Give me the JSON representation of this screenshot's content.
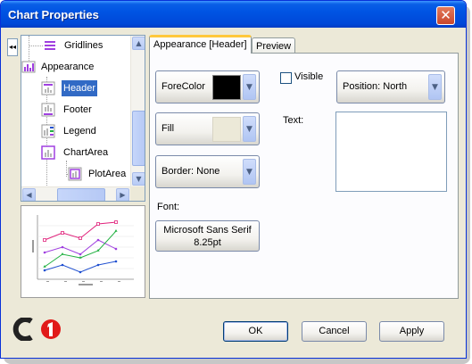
{
  "window": {
    "title": "Chart Properties"
  },
  "tree": {
    "items": [
      {
        "label": "Gridlines"
      },
      {
        "label": "Appearance"
      },
      {
        "label": "Header",
        "selected": true
      },
      {
        "label": "Footer"
      },
      {
        "label": "Legend"
      },
      {
        "label": "ChartArea"
      },
      {
        "label": "PlotArea"
      }
    ]
  },
  "preview_chart": {
    "series_colors": [
      "#e0207a",
      "#a040e0",
      "#20b040",
      "#2050d0"
    ]
  },
  "tabs": [
    {
      "label": "Appearance [Header]",
      "active": true
    },
    {
      "label": "Preview",
      "active": false
    }
  ],
  "appearance": {
    "forecolor_label": "ForeColor",
    "forecolor_value": "#000000",
    "fill_label": "Fill",
    "fill_value": "#ece9d8",
    "border_label": "Border: None",
    "visible_label": "Visible",
    "visible_checked": false,
    "position_label": "Position: North",
    "text_label": "Text:",
    "text_value": "",
    "font_label": "Font:",
    "font_line1": "Microsoft Sans Serif",
    "font_line2": "8.25pt"
  },
  "buttons": {
    "ok": "OK",
    "cancel": "Cancel",
    "apply": "Apply"
  },
  "colors": {
    "selection": "#316ac5",
    "titlebar": "#0054e3",
    "tab_accent": "#ffc83c"
  }
}
